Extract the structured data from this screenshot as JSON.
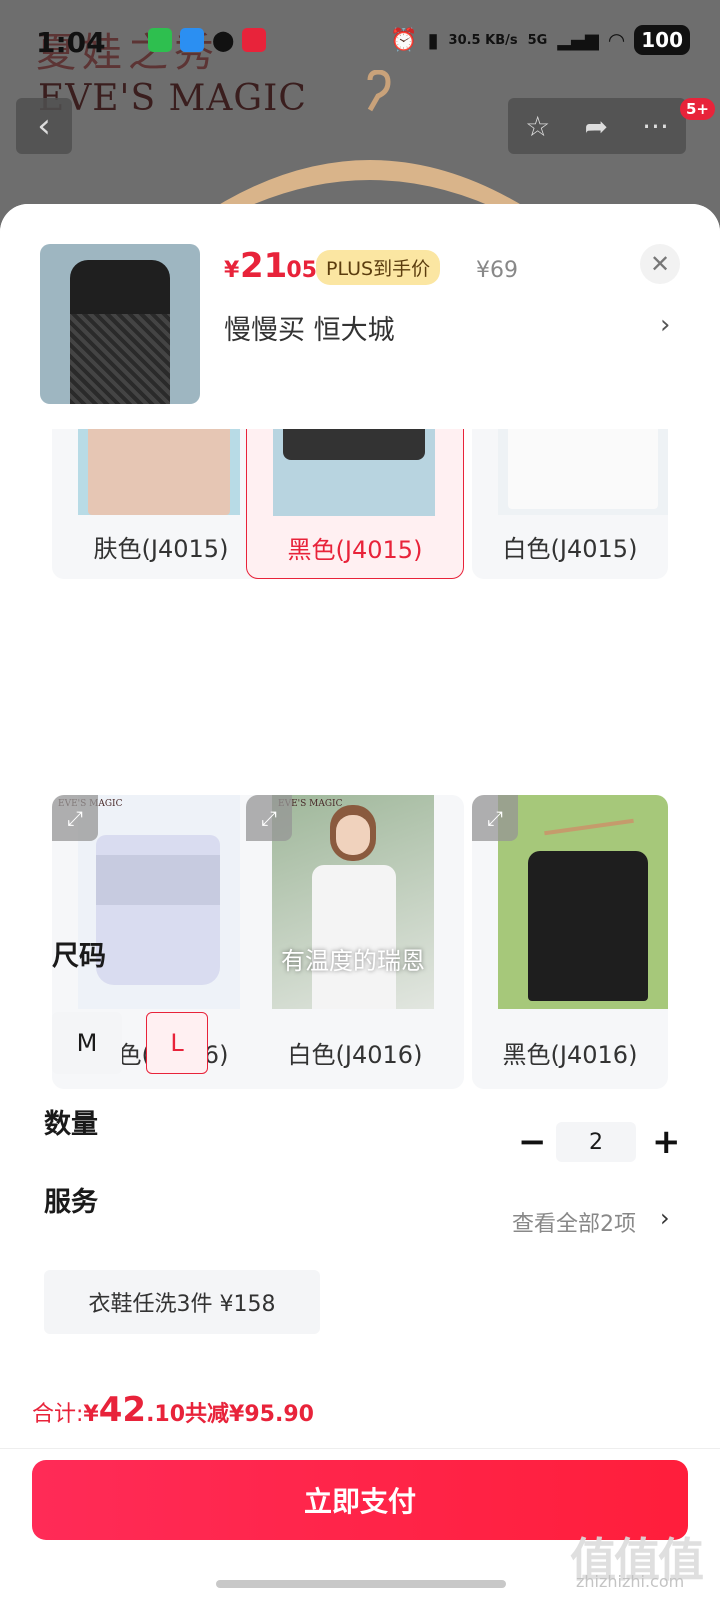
{
  "status_bar": {
    "time": "1:04",
    "net_speed": "30.5 KB/s",
    "network": "5G",
    "battery": "100"
  },
  "background": {
    "brand_cn": "夏娃之秀",
    "brand_en": "EVE'S MAGIC",
    "badge": "5+"
  },
  "header": {
    "price_symbol": "¥",
    "price_int": "21",
    "price_dec": ".05",
    "plus_tag": "PLUS到手价",
    "original_price": "¥69",
    "address": "慢慢买  恒大城",
    "close_icon": "close-icon"
  },
  "colors_grid": [
    {
      "label": "肤色(J4015)",
      "selected": false
    },
    {
      "label": "黑色(J4015)",
      "selected": true
    },
    {
      "label": "白色(J4015)",
      "selected": false
    },
    {
      "label": "灰色(J4016)",
      "selected": false
    },
    {
      "label": "白色(J4016)",
      "selected": false,
      "image_caption": "有温度的瑞恩"
    },
    {
      "label": "黑色(J4016)",
      "selected": false
    }
  ],
  "size": {
    "title": "尺码",
    "options": [
      "M",
      "L"
    ],
    "selected": "L"
  },
  "quantity": {
    "title": "数量",
    "value": "2",
    "minus": "−",
    "plus": "+"
  },
  "service": {
    "title": "服务",
    "view_all": "查看全部2项",
    "chip": "衣鞋任洗3件  ¥158"
  },
  "footer": {
    "total_label": "合计: ",
    "total_symbol": "¥",
    "total_int": "42",
    "total_dec": ".10",
    "discount": " 共减¥95.90",
    "pay_button": "立即支付"
  },
  "watermark": {
    "text": "值值值",
    "url": "zhizhizhi.com"
  },
  "theme": {
    "accent": "#e8233a",
    "plus_bg": "#fbe6a2"
  }
}
